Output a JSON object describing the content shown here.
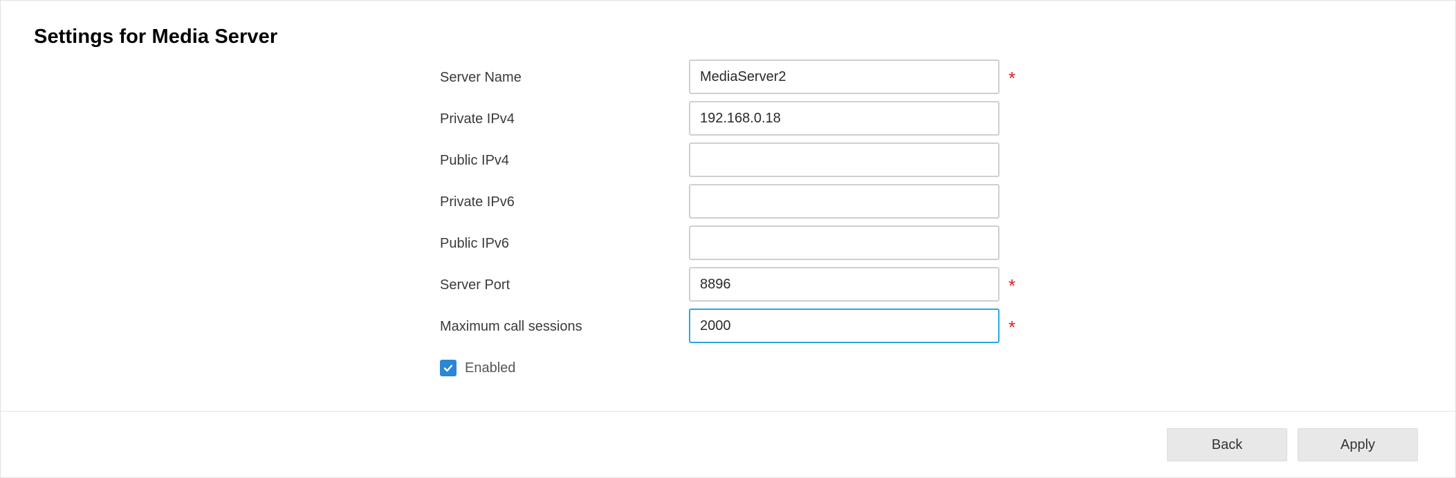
{
  "page": {
    "title": "Settings for Media Server"
  },
  "form": {
    "server_name": {
      "label": "Server Name",
      "value": "MediaServer2",
      "required_mark": "*"
    },
    "private_ipv4": {
      "label": "Private IPv4",
      "value": "192.168.0.18"
    },
    "public_ipv4": {
      "label": "Public IPv4",
      "value": ""
    },
    "private_ipv6": {
      "label": "Private IPv6",
      "value": ""
    },
    "public_ipv6": {
      "label": "Public IPv6",
      "value": ""
    },
    "server_port": {
      "label": "Server Port",
      "value": "8896",
      "required_mark": "*"
    },
    "max_call_sessions": {
      "label": "Maximum call sessions",
      "value": "2000",
      "required_mark": "*"
    },
    "enabled": {
      "label": "Enabled",
      "checked": true
    }
  },
  "footer": {
    "back_label": "Back",
    "apply_label": "Apply"
  },
  "colors": {
    "focus_border": "#29a7e1",
    "required": "#e01e1e",
    "checkbox": "#2b86d6",
    "button_bg": "#e8e8e8"
  },
  "icons": {
    "checkbox": "checkmark-icon"
  }
}
